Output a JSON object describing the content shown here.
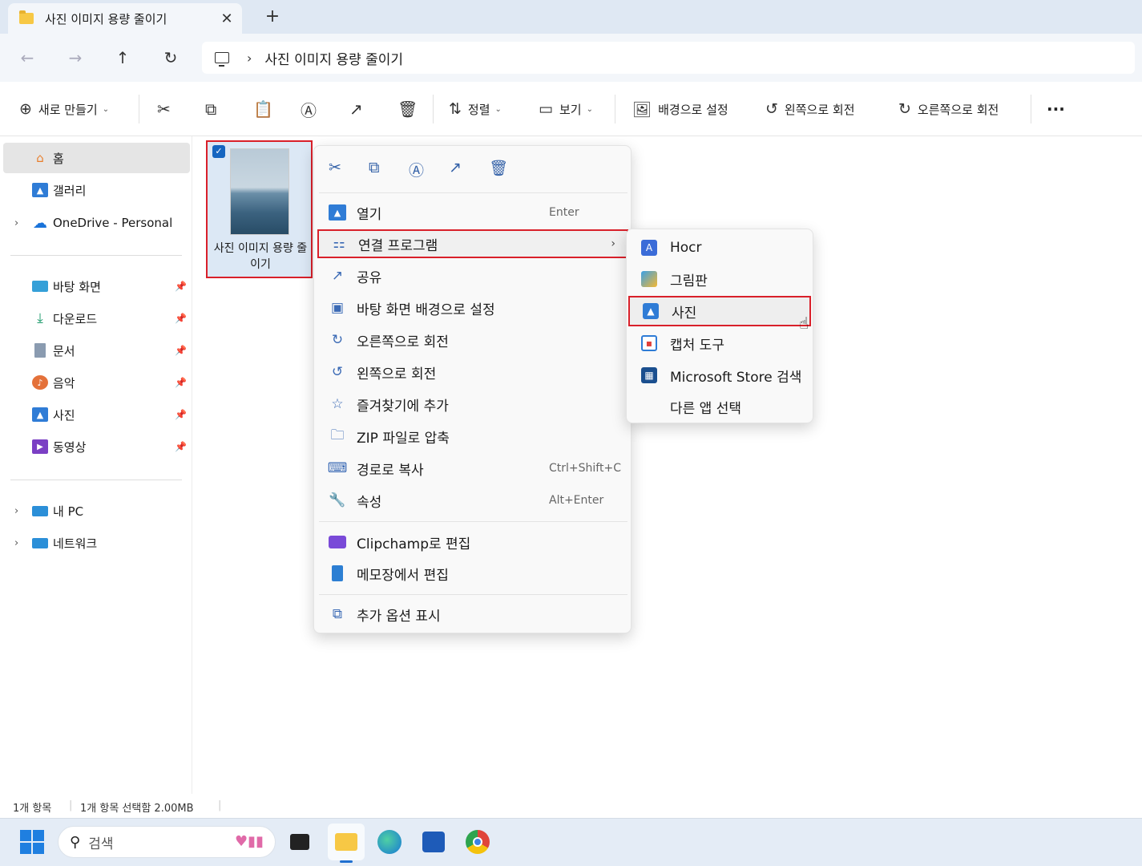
{
  "window": {
    "tab_title": "사진 이미지 용량 줄이기",
    "tab_close": "✕",
    "new_tab": "+"
  },
  "nav": {
    "back": "←",
    "forward": "→",
    "up": "↑",
    "refresh": "↻",
    "breadcrumb_sep": "›",
    "breadcrumb": "사진 이미지 용량 줄이기"
  },
  "toolbar": {
    "new_label": "새로 만들기",
    "sort_label": "정렬",
    "view_label": "보기",
    "set_background_label": "배경으로 설정",
    "rotate_left_label": "왼쪽으로 회전",
    "rotate_right_label": "오른쪽으로 회전",
    "more_label": "···"
  },
  "sidebar": {
    "home": "홈",
    "gallery": "갤러리",
    "onedrive": "OneDrive - Personal",
    "quick_access": [
      "바탕 화면",
      "다운로드",
      "문서",
      "음악",
      "사진",
      "동영상"
    ],
    "this_pc": "내 PC",
    "network": "네트워크"
  },
  "file": {
    "name": "사진 이미지 용량 줄이기",
    "checked": true
  },
  "context_menu": {
    "open": {
      "label": "열기",
      "shortcut": "Enter"
    },
    "open_with": {
      "label": "연결 프로그램"
    },
    "share": {
      "label": "공유"
    },
    "set_desktop_bg": {
      "label": "바탕 화면 배경으로 설정"
    },
    "rotate_right": {
      "label": "오른쪽으로 회전"
    },
    "rotate_left": {
      "label": "왼쪽으로 회전"
    },
    "add_favorite": {
      "label": "즐겨찾기에 추가"
    },
    "zip": {
      "label": "ZIP 파일로 압축"
    },
    "copy_path": {
      "label": "경로로 복사",
      "shortcut": "Ctrl+Shift+C"
    },
    "properties": {
      "label": "속성",
      "shortcut": "Alt+Enter"
    },
    "clipchamp": {
      "label": "Clipchamp로 편집"
    },
    "notepad": {
      "label": "메모장에서 편집"
    },
    "more_options": {
      "label": "추가 옵션 표시"
    }
  },
  "submenu": {
    "items": [
      "Hocr",
      "그림판",
      "사진",
      "캡처 도구",
      "Microsoft Store 검색",
      "다른 앱 선택"
    ],
    "highlighted": "사진"
  },
  "status": {
    "count": "1개 항목",
    "selection": "1개 항목 선택함 2.00MB"
  },
  "taskbar": {
    "search_placeholder": "검색"
  },
  "colors": {
    "highlight_border": "#d9202a",
    "accent": "#1f6fd0"
  }
}
